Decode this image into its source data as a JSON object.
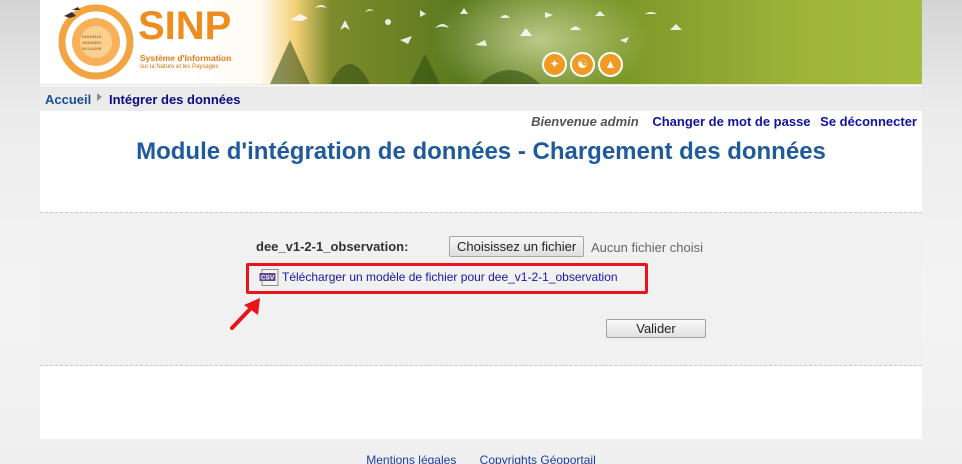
{
  "banner": {
    "logo_text": "SINP",
    "logo_subtitle_1": "Système d'Information",
    "logo_subtitle_2": "sur la Nature et les Paysages",
    "logo_ring_text": "CONNAISSANCE • SYSTÈME D'INFORMATION",
    "theme_icons": [
      "bird-icon",
      "landscape-icon",
      "mountain-icon"
    ]
  },
  "breadcrumb": {
    "home": "Accueil",
    "current": "Intégrer des données"
  },
  "user_bar": {
    "welcome": "Bienvenue admin",
    "change_password": "Changer de mot de passe",
    "logout": "Se déconnecter"
  },
  "page": {
    "title": "Module d'intégration de données - Chargement des données"
  },
  "form": {
    "field_label": "dee_v1-2-1_observation:",
    "file_button": "Choisissez un fichier",
    "file_status": "Aucun fichier choisi",
    "csv_icon_text": "CSV",
    "template_link": "Télécharger un modèle de fichier pour dee_v1-2-1_observation",
    "submit": "Valider"
  },
  "footer": {
    "legal": "Mentions légales",
    "copyrights": "Copyrights Géoportail"
  },
  "colors": {
    "title": "#1f5a9b",
    "highlight": "#e8141a",
    "logo_orange": "#ef8c20"
  }
}
